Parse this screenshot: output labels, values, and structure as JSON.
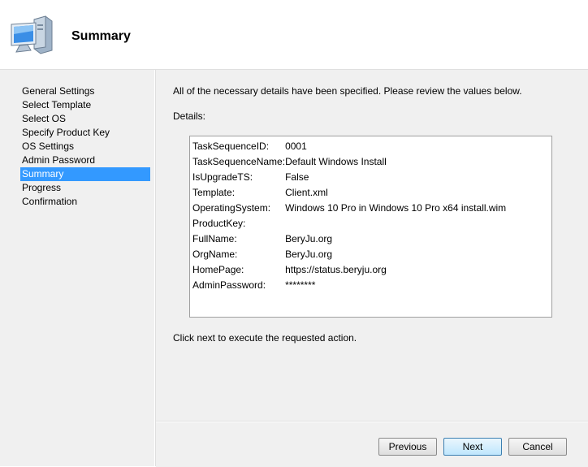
{
  "header": {
    "title": "Summary",
    "icon": "computer-icon"
  },
  "nav": {
    "items": [
      {
        "label": "General Settings"
      },
      {
        "label": "Select Template"
      },
      {
        "label": "Select OS"
      },
      {
        "label": "Specify Product Key"
      },
      {
        "label": "OS Settings"
      },
      {
        "label": "Admin Password"
      },
      {
        "label": "Summary",
        "selected": true
      },
      {
        "label": "Progress"
      },
      {
        "label": "Confirmation"
      }
    ]
  },
  "main": {
    "intro": "All of the necessary details have been specified.  Please review the values below.",
    "details_label": "Details:",
    "details": [
      {
        "key": "TaskSequenceID:",
        "value": "0001"
      },
      {
        "key": "TaskSequenceName:",
        "value": "Default Windows Install"
      },
      {
        "key": "IsUpgradeTS:",
        "value": "False"
      },
      {
        "key": "Template:",
        "value": "Client.xml"
      },
      {
        "key": "OperatingSystem:",
        "value": "Windows 10 Pro in Windows 10 Pro x64 install.wim"
      },
      {
        "key": "ProductKey:",
        "value": ""
      },
      {
        "key": "FullName:",
        "value": "BeryJu.org"
      },
      {
        "key": "OrgName:",
        "value": "BeryJu.org"
      },
      {
        "key": "HomePage:",
        "value": "https://status.beryju.org"
      },
      {
        "key": "AdminPassword:",
        "value": "********"
      }
    ],
    "footer_note": "Click next to execute the requested action."
  },
  "buttons": {
    "previous": "Previous",
    "next": "Next",
    "cancel": "Cancel"
  },
  "colors": {
    "selection": "#3399ff",
    "panel": "#f0f0f0"
  }
}
